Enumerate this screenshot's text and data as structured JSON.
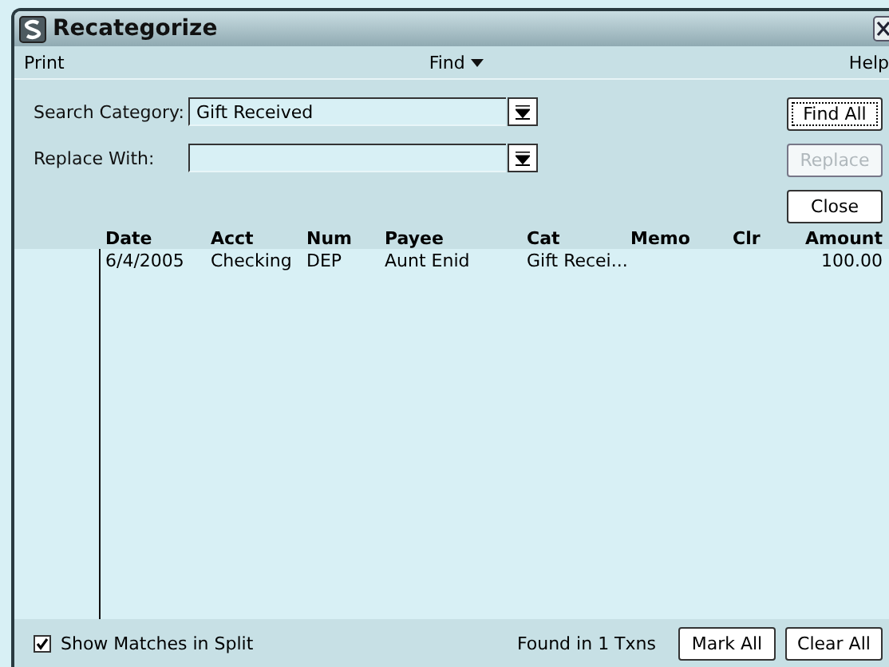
{
  "window": {
    "title": "Recategorize"
  },
  "menu": [
    {
      "label": "Print",
      "kind": "plain"
    },
    {
      "label": "Find",
      "kind": "dropdown"
    },
    {
      "label": "Help",
      "kind": "plain"
    }
  ],
  "search_category": {
    "label": "Search Category:",
    "value": "Gift Received"
  },
  "replace_with": {
    "label": "Replace With:"
  },
  "side_buttons": [
    {
      "label": "Find All",
      "disabled": false,
      "focused": true
    },
    {
      "label": "Replace",
      "disabled": true,
      "focused": false
    },
    {
      "label": "Close",
      "disabled": false,
      "focused": false
    }
  ],
  "table": {
    "columns": [
      "Date",
      "Acct",
      "Num",
      "Payee",
      "Cat",
      "Memo",
      "Clr",
      "Amount"
    ],
    "rows": [
      {
        "date": "6/4/2005",
        "acct": "Checking",
        "num": "DEP",
        "payee": "Aunt Enid",
        "cat": "Gift Recei...",
        "amount": "100.00"
      }
    ]
  },
  "show_matches": {
    "label": "Show Matches in Split",
    "checked": true
  },
  "found_text": "Found in 1 Txns",
  "bottom_buttons": [
    {
      "label": "Mark All"
    },
    {
      "label": "Clear All"
    }
  ]
}
